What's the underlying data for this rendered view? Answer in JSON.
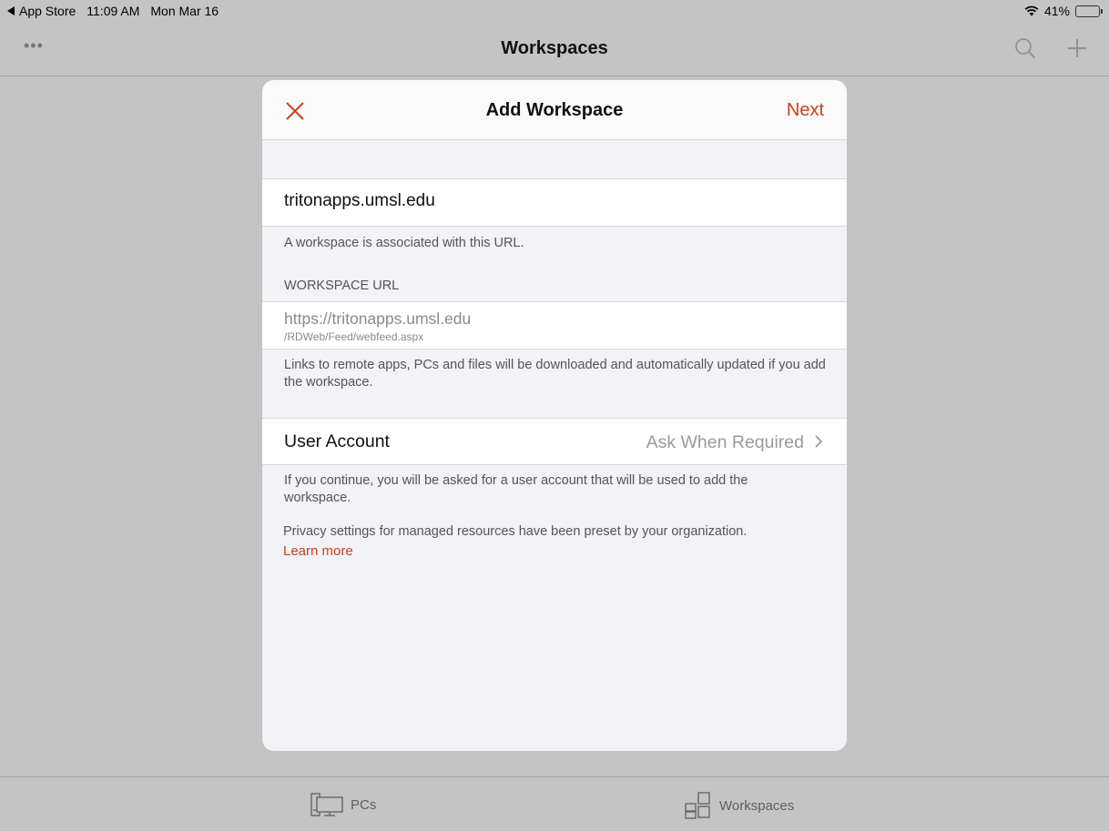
{
  "status_bar": {
    "back_app": "App Store",
    "time": "11:09 AM",
    "date": "Mon Mar 16",
    "battery": "41%",
    "battery_level": 0.41
  },
  "nav": {
    "title": "Workspaces",
    "more": "•••"
  },
  "modal": {
    "title": "Add Workspace",
    "next": "Next",
    "url_value": "tritonapps.umsl.edu",
    "url_help": "A workspace is associated with this URL.",
    "workspace_url_header": "WORKSPACE URL",
    "workspace_url_main": "https://tritonapps.umsl.edu",
    "workspace_url_sub": "/RDWeb/Feed/webfeed.aspx",
    "workspace_help": "Links to remote apps, PCs and files will be downloaded and automatically updated if you add the workspace.",
    "user_account_label": "User Account",
    "user_account_value": "Ask When Required",
    "account_help": "If you continue, you will be asked for a user account that will be used to add the workspace.",
    "privacy_text": "Privacy settings for managed resources have been preset by your organization.",
    "learn_more": "Learn more"
  },
  "tabs": [
    {
      "label": "PCs",
      "icon": "pcs-icon"
    },
    {
      "label": "Workspaces",
      "icon": "workspaces-icon"
    }
  ],
  "colors": {
    "accent": "#c8401e"
  }
}
